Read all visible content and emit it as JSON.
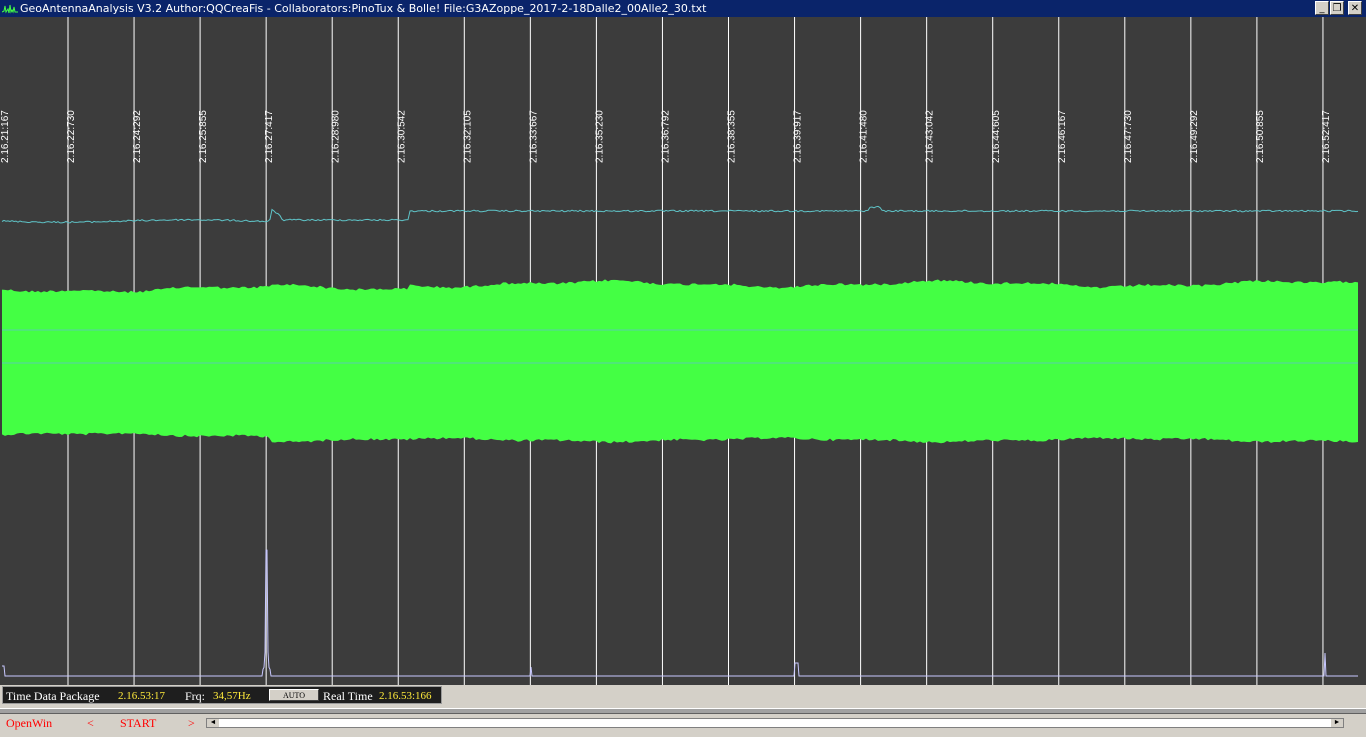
{
  "window": {
    "title": "GeoAntennaAnalysis V3.2 Author:QQCreaFis - Collaborators:PinoTux & Bolle!    File:G3AZoppe_2017-2-18Dalle2_00Alle2_30.txt",
    "minimize_label": "_",
    "restore_label": "❐",
    "close_label": "✕"
  },
  "colors": {
    "plot_bg": "#3c3c3c",
    "grid": "#ffffff",
    "trace_top": "#5fc4c8",
    "signal_band": "#44ff44",
    "signal_center": "#5fc4c8",
    "spike_trace": "#c8c8ff",
    "status_value": "#ffeb3b",
    "nav_text": "#ff0000"
  },
  "chart_data": {
    "type": "line",
    "time_markers": [
      "2.16.21:167",
      "2.16.22:730",
      "2.16.24:292",
      "2.16.25:855",
      "2.16.27:417",
      "2.16.28:980",
      "2.16.30:542",
      "2.16.32:105",
      "2.16.33:667",
      "2.16.35:230",
      "2.16.36:792",
      "2.16.38:355",
      "2.16.39:917",
      "2.16.41:480",
      "2.16.43:042",
      "2.16.44:605",
      "2.16.46:167",
      "2.16.47:730",
      "2.16.49:292",
      "2.16.50:855",
      "2.16.52:417"
    ],
    "grid": true
  },
  "status": {
    "time_label": "Time Data Package",
    "time_value": "2.16.53:17",
    "frq_label": "Frq:",
    "frq_value": "34,57Hz",
    "auto_label": "AUTO",
    "real_time_label": "Real Time",
    "real_time_value": "2.16.53:166"
  },
  "nav": {
    "openwin_label": "OpenWin",
    "prev_label": "<",
    "start_label": "START",
    "next_label": ">"
  },
  "scrollbar": {
    "left_arrow": "◄",
    "right_arrow": "►"
  }
}
